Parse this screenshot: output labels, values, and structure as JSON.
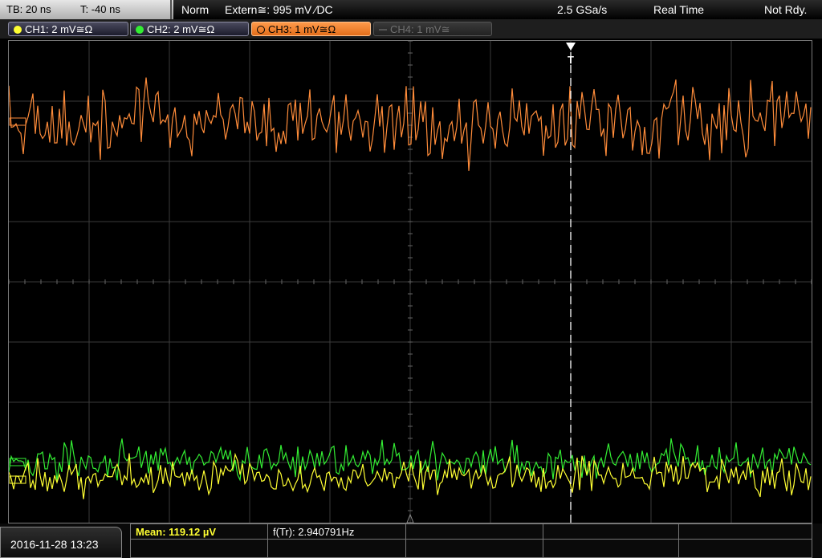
{
  "top": {
    "timebase": "TB: 20 ns",
    "trigger_time": "T: -40 ns",
    "mode": "Norm",
    "trigger_source": "Extern≅: 995 mV ⁄DC",
    "sample_rate": "2.5 GSa/s",
    "acquisition": "Real Time",
    "status": "Not Rdy."
  },
  "channels": [
    {
      "label": "CH1: 2 mV≅Ω",
      "color": "#ffff33"
    },
    {
      "label": "CH2: 2 mV≅Ω",
      "color": "#33ee33"
    },
    {
      "label": "CH3: 1 mV≅Ω",
      "color": "#ff8c3a"
    },
    {
      "label": "CH4: 1 mV≅",
      "color": "#707070"
    }
  ],
  "display": {
    "trigger_marker": "T",
    "colors": {
      "ch1": "#ffff33",
      "ch2": "#33ee33",
      "ch3": "#ff8c3a",
      "grid": "#3a3a3a"
    },
    "trigger_position_fraction": 0.7
  },
  "footer": {
    "datetime": "2016-11-28 13:23",
    "mean": "Mean: 119.12 µV",
    "frequency": "f(Tr): 2.940791Hz",
    "mean_color": "#ffff33"
  }
}
